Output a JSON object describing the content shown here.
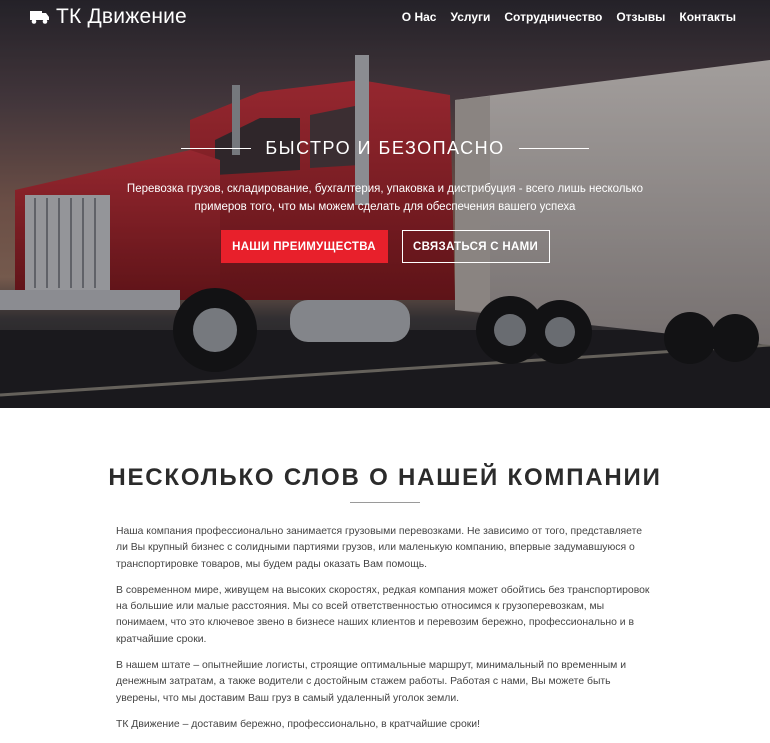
{
  "brand": {
    "name": "ТК Движение",
    "icon": "truck-icon"
  },
  "nav": {
    "items": [
      {
        "label": "О Нас"
      },
      {
        "label": "Услуги"
      },
      {
        "label": "Сотрудничество"
      },
      {
        "label": "Отзывы"
      },
      {
        "label": "Контакты"
      }
    ]
  },
  "hero": {
    "title": "БЫСТРО И БЕЗОПАСНО",
    "subtitle": "Перевозка грузов, складирование, бухгалтерия, упаковка и дистрибуция - всего лишь несколько примеров того, что мы можем сделать для обеспечения вашего успеха",
    "primary_button": "НАШИ ПРЕИМУЩЕСТВА",
    "secondary_button": "СВЯЗАТЬСЯ С НАМИ"
  },
  "about": {
    "title": "НЕСКОЛЬКО СЛОВ О НАШЕЙ КОМПАНИИ",
    "paragraphs": [
      "Наша компания профессионально занимается грузовыми перевозками. Не зависимо от того, представляете ли Вы крупный бизнес с солидными партиями грузов, или маленькую компанию, впервые задумавшуюся о транспортировке товаров, мы будем рады оказать Вам помощь.",
      "В современном мире, живущем на высоких скоростях, редкая компания может обойтись без транспортировок на большие или малые расстояния. Мы со всей ответственностью относимся к грузоперевозкам, мы понимаем, что это ключевое звено в бизнесе наших клиентов и перевозим бережно, профессионально и в кратчайшие сроки.",
      "В нашем штате – опытнейшие логисты, строящие оптимальные маршрут, минимальный по временным и денежным затратам, а также водители с достойным стажем работы. Работая с нами, Вы можете быть уверены, что мы доставим Ваш груз в самый удаленный уголок земли.",
      "ТК Движение – доставим бережно, профессионально, в кратчайшие сроки!"
    ]
  },
  "colors": {
    "accent": "#e8202b",
    "truck_cab": "#a8212a",
    "text": "#444444"
  }
}
